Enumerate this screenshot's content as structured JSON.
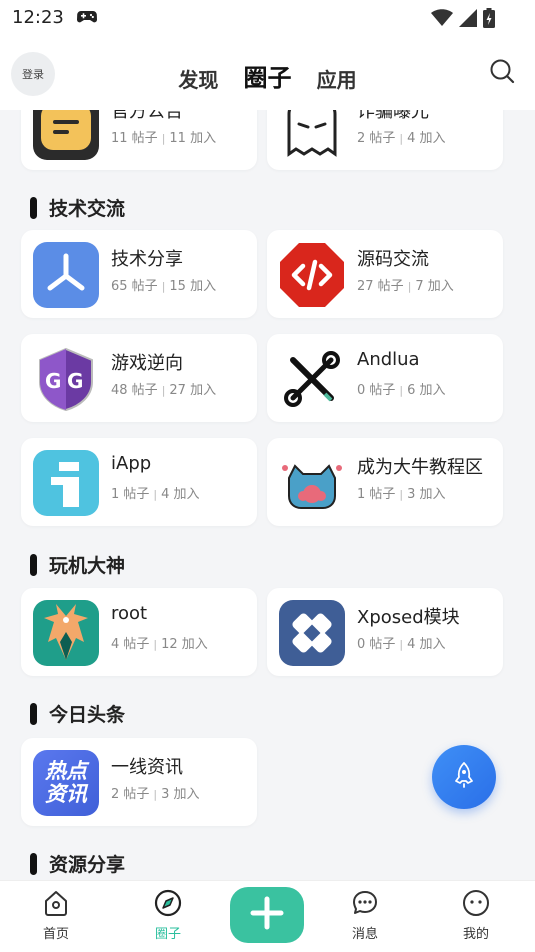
{
  "status": {
    "time": "12:23"
  },
  "header": {
    "login_label": "登录",
    "tabs": [
      {
        "label": "发现"
      },
      {
        "label": "圈子"
      },
      {
        "label": "应用"
      }
    ]
  },
  "partial_top": [
    {
      "name": "官方公告",
      "posts": "11 帖子",
      "joins": "11 加入"
    },
    {
      "name": "诈骗曝光",
      "posts": "2 帖子",
      "joins": "4 加入"
    }
  ],
  "sections": [
    {
      "title": "技术交流",
      "items": [
        {
          "name": "技术分享",
          "posts": "65 帖子",
          "joins": "15 加入",
          "icon": "tech-share-icon",
          "color": "#5b8de6"
        },
        {
          "name": "源码交流",
          "posts": "27 帖子",
          "joins": "7 加入",
          "icon": "source-code-icon",
          "color": "#d9261c"
        },
        {
          "name": "游戏逆向",
          "posts": "48 帖子",
          "joins": "27 加入",
          "icon": "game-guardian-icon",
          "color": "#7c3fb5"
        },
        {
          "name": "Andlua",
          "posts": "0 帖子",
          "joins": "6 加入",
          "icon": "tools-icon",
          "color": "#111111"
        },
        {
          "name": "iApp",
          "posts": "1 帖子",
          "joins": "4 加入",
          "icon": "iapp-icon",
          "color": "#4fc3e0"
        },
        {
          "name": "成为大牛教程区",
          "posts": "1 帖子",
          "joins": "3 加入",
          "icon": "cute-cat-icon",
          "color": "#4aa0c8"
        }
      ]
    },
    {
      "title": "玩机大神",
      "items": [
        {
          "name": "root",
          "posts": "4 帖子",
          "joins": "12 加入",
          "icon": "magisk-icon",
          "color": "#1f9e8a"
        },
        {
          "name": "Xposed模块",
          "posts": "0 帖子",
          "joins": "4 加入",
          "icon": "xposed-icon",
          "color": "#3f5e96"
        }
      ]
    },
    {
      "title": "今日头条",
      "items": [
        {
          "name": "一线资讯",
          "posts": "2 帖子",
          "joins": "3 加入",
          "icon": "hot-news-icon",
          "color": "#4a68e6",
          "icon_text": "热点资讯"
        }
      ]
    },
    {
      "title": "资源分享",
      "items": []
    }
  ],
  "bottom_nav": [
    {
      "label": "首页"
    },
    {
      "label": "圈子"
    },
    {
      "label": "消息"
    },
    {
      "label": "我的"
    }
  ],
  "colors": {
    "accent": "#3ac2a0",
    "fab": "#3f8ff6"
  }
}
